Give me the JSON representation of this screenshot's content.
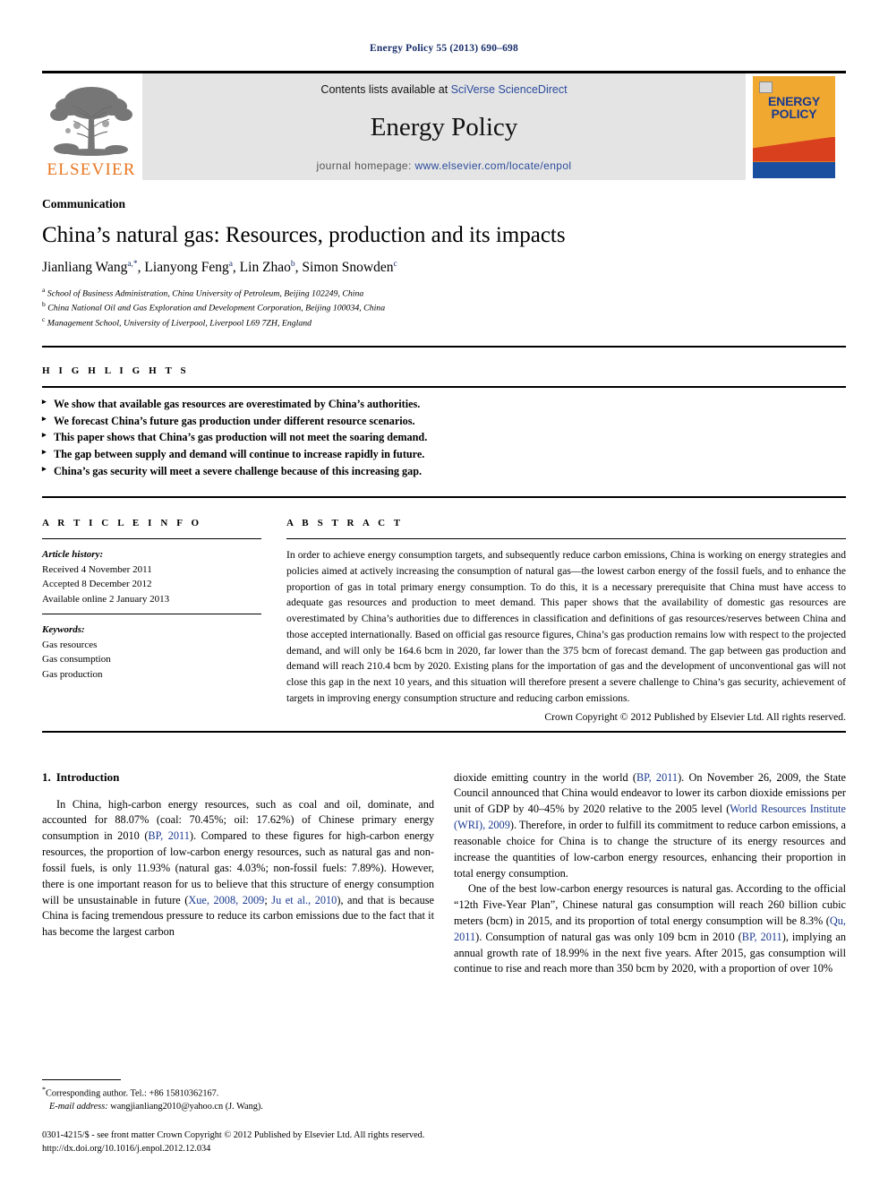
{
  "running_head": "Energy Policy 55 (2013) 690–698",
  "masthead": {
    "publisher_name": "ELSEVIER",
    "contents_prefix": "Contents lists available at ",
    "contents_link": "SciVerse ScienceDirect",
    "journal_title": "Energy Policy",
    "homepage_prefix": "journal homepage: ",
    "homepage_link": "www.elsevier.com/locate/enpol",
    "cover_title_line1": "ENERGY",
    "cover_title_line2": "POLICY",
    "colors": {
      "elsevier_orange": "#E87722",
      "link_blue": "#2b4b9b",
      "cover_amber": "#F0A830",
      "cover_red": "#D9411E",
      "cover_blue": "#1A4FA0",
      "band_gray": "#e4e4e4"
    }
  },
  "article": {
    "type": "Communication",
    "title": "China’s natural gas: Resources, production and its impacts",
    "authors": [
      {
        "name": "Jianliang Wang",
        "marks": "a,*"
      },
      {
        "name": "Lianyong Feng",
        "marks": "a"
      },
      {
        "name": "Lin Zhao",
        "marks": "b"
      },
      {
        "name": "Simon Snowden",
        "marks": "c"
      }
    ],
    "affiliations": [
      {
        "mark": "a",
        "text": "School of Business Administration, China University of Petroleum, Beijing 102249, China"
      },
      {
        "mark": "b",
        "text": "China National Oil and Gas Exploration and Development Corporation, Beijing 100034, China"
      },
      {
        "mark": "c",
        "text": "Management School, University of Liverpool, Liverpool L69 7ZH, England"
      }
    ]
  },
  "highlights": {
    "label": "H I G H L I G H T S",
    "items": [
      "We show that available gas resources are overestimated by China’s authorities.",
      "We forecast China’s future gas production under different resource scenarios.",
      "This paper shows that China’s gas production will not meet the soaring demand.",
      "The gap between supply and demand will continue to increase rapidly in future.",
      "China’s gas security will meet a severe challenge because of this increasing gap."
    ]
  },
  "article_info": {
    "label": "A R T I C L E  I N F O",
    "history_heading": "Article history:",
    "history": [
      "Received 4 November 2011",
      "Accepted 8 December 2012",
      "Available online 2 January 2013"
    ],
    "keywords_heading": "Keywords:",
    "keywords": [
      "Gas resources",
      "Gas consumption",
      "Gas production"
    ]
  },
  "abstract": {
    "label": "A B S T R A C T",
    "text": "In order to achieve energy consumption targets, and subsequently reduce carbon emissions, China is working on energy strategies and policies aimed at actively increasing the consumption of natural gas—the lowest carbon energy of the fossil fuels, and to enhance the proportion of gas in total primary energy consumption. To do this, it is a necessary prerequisite that China must have access to adequate gas resources and production to meet demand. This paper shows that the availability of domestic gas resources are overestimated by China’s authorities due to differences in classification and definitions of gas resources/reserves between China and those accepted internationally. Based on official gas resource figures, China’s gas production remains low with respect to the projected demand, and will only be 164.6 bcm in 2020, far lower than the 375 bcm of forecast demand. The gap between gas production and demand will reach 210.4 bcm by 2020. Existing plans for the importation of gas and the development of unconventional gas will not close this gap in the next 10 years, and this situation will therefore present a severe challenge to China’s gas security, achievement of targets in improving energy consumption structure and reducing carbon emissions.",
    "copyright": "Crown Copyright © 2012 Published by Elsevier Ltd. All rights reserved."
  },
  "introduction": {
    "number": "1.",
    "title": "Introduction",
    "left_para_1_a": "In China, high-carbon energy resources, such as coal and oil, dominate, and accounted for 88.07% (coal: 70.45%; oil: 17.62%) of Chinese primary energy consumption in 2010 (",
    "left_ref_1": "BP, 2011",
    "left_para_1_b": "). Compared to these figures for high-carbon energy resources, the proportion of low-carbon energy resources, such as natural gas and non-fossil fuels, is only 11.93% (natural gas: 4.03%; non-fossil fuels: 7.89%). However, there is one important reason for us to believe that this structure of energy consumption will be unsustainable in future (",
    "left_ref_2": "Xue, 2008, 2009",
    "left_para_1_c": "; ",
    "left_ref_3": "Ju et al., 2010",
    "left_para_1_d": "), and that is because China is facing tremendous pressure to reduce its carbon emissions due to the fact that it has become the largest carbon ",
    "right_para_1_a": "dioxide emitting country in the world (",
    "right_ref_1": "BP, 2011",
    "right_para_1_b": "). On November 26, 2009, the State Council announced that China would endeavor to lower its carbon dioxide emissions per unit of GDP by 40–45% by 2020 relative to the 2005 level (",
    "right_ref_2": "World Resources Institute (WRI), 2009",
    "right_para_1_c": "). Therefore, in order to fulfill its commitment to reduce carbon emissions, a reasonable choice for China is to change the structure of its energy resources and increase the quantities of low-carbon energy resources, enhancing their proportion in total energy consumption.",
    "right_para_2_a": "One of the best low-carbon energy resources is natural gas. According to the official “12th Five-Year Plan”, Chinese natural gas consumption will reach 260 billion cubic meters (bcm) in 2015, and its proportion of total energy consumption will be 8.3% (",
    "right_ref_3": "Qu, 2011",
    "right_para_2_b": "). Consumption of natural gas was only 109 bcm in 2010 (",
    "right_ref_4": "BP, 2011",
    "right_para_2_c": "), implying an annual growth rate of 18.99% in the next five years. After 2015, gas consumption will continue to rise and reach more than 350 bcm by 2020, with a proportion of over 10%"
  },
  "footer": {
    "corresponding_mark": "*",
    "corresponding": "Corresponding author. Tel.: +86 15810362167.",
    "email_label": "E-mail address:",
    "email": "wangjianliang2010@yahoo.cn (J. Wang).",
    "issn_line": "0301-4215/$ - see front matter Crown Copyright © 2012 Published by Elsevier Ltd. All rights reserved.",
    "doi_line": "http://dx.doi.org/10.1016/j.enpol.2012.12.034"
  }
}
